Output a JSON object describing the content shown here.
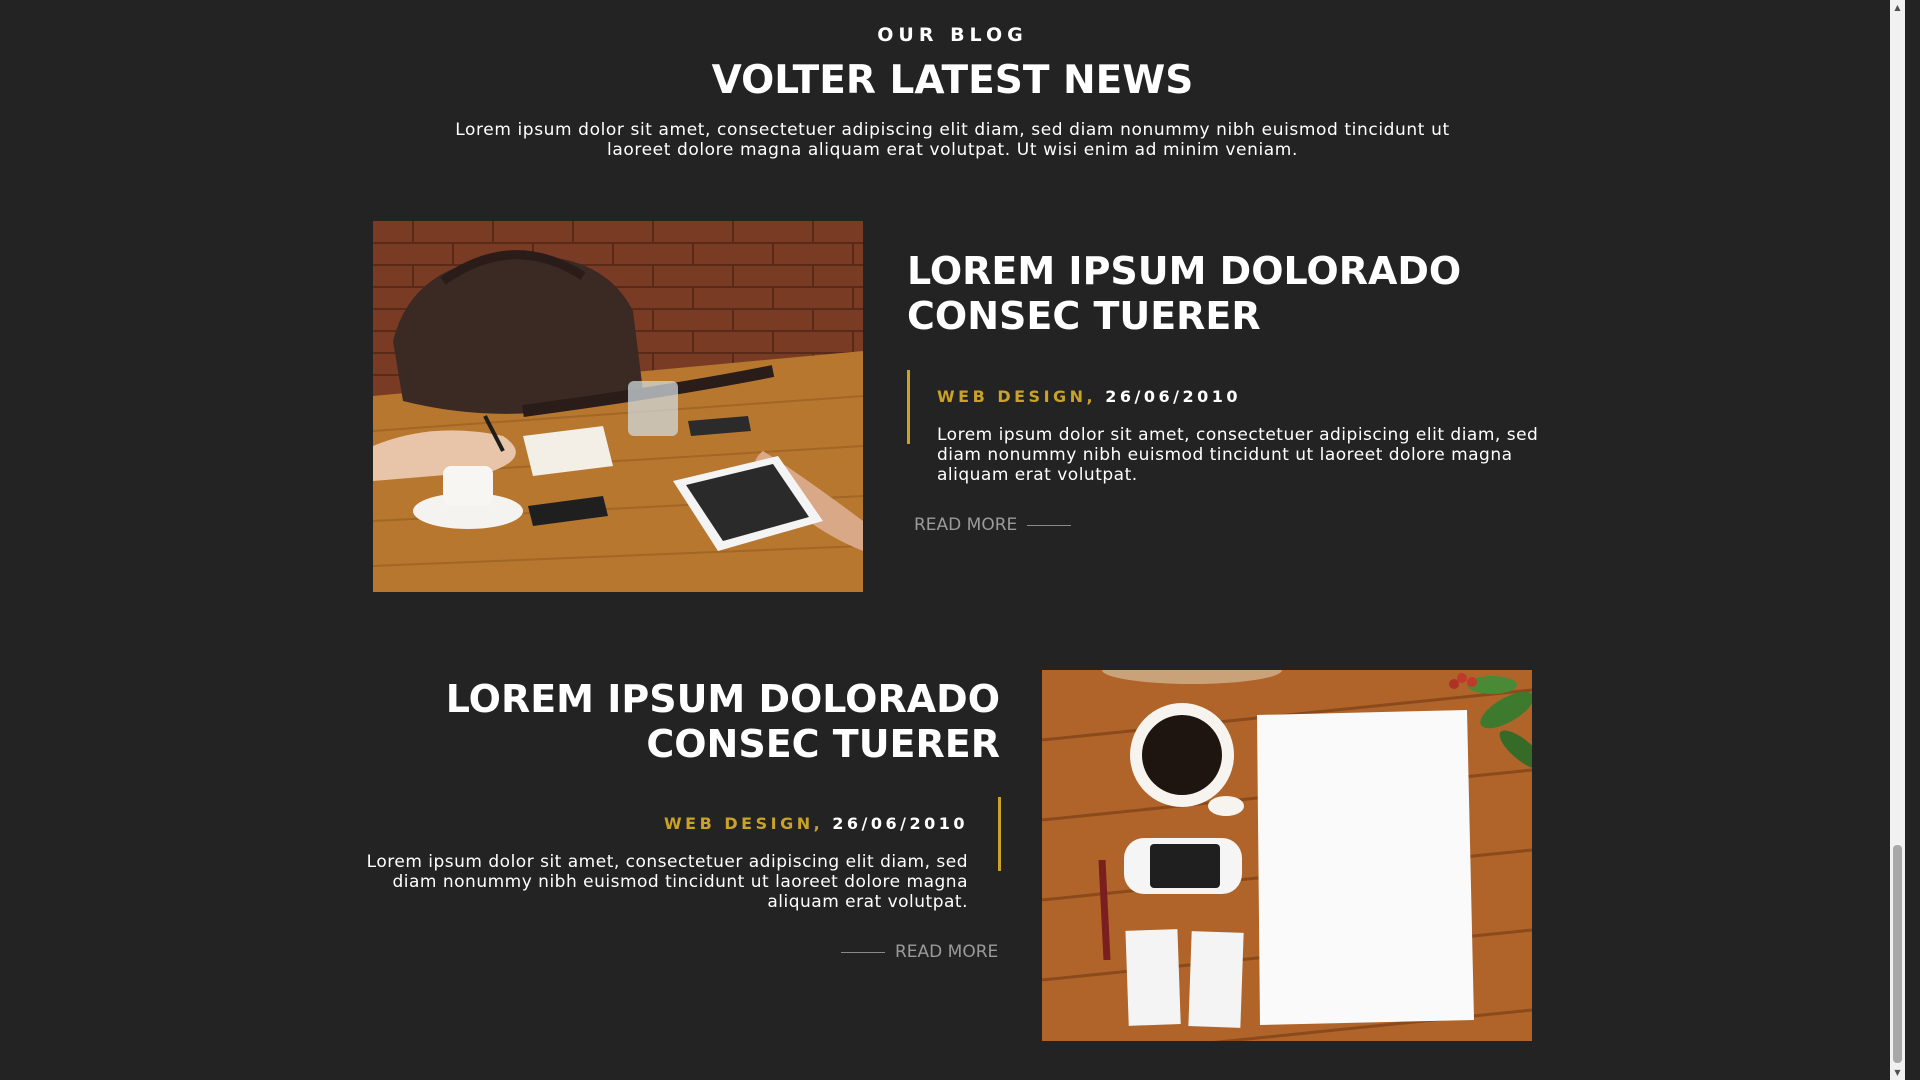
{
  "blog": {
    "eyebrow": "OUR BLOG",
    "heading": "VOLTER LATEST NEWS",
    "intro": "Lorem ipsum dolor sit amet, consectetuer adipiscing elit diam, sed diam nonummy nibh euismod tincidunt ut laoreet dolore magna aliquam erat volutpat. Ut wisi enim ad minim veniam."
  },
  "posts": [
    {
      "title": "LOREM IPSUM DOLORADO CONSEC TUERER",
      "category": "WEB DESIGN,",
      "date": "26/06/2010",
      "excerpt": "Lorem ipsum dolor sit amet, consectetuer adipiscing elit diam, sed diam nonummy nibh euismod tincidunt ut laoreet dolore magna aliquam erat volutpat.",
      "read_more": "READ MORE"
    },
    {
      "title": "LOREM IPSUM DOLORADO CONSEC TUERER",
      "category": "WEB DESIGN,",
      "date": "26/06/2010",
      "excerpt": "Lorem ipsum dolor sit amet, consectetuer adipiscing elit diam, sed diam nonummy nibh euismod tincidunt ut laoreet dolore magna aliquam erat volutpat.",
      "read_more": "READ MORE"
    }
  ],
  "colors": {
    "background": "#232323",
    "accent": "#c9a227",
    "text": "#ffffff",
    "muted": "#9a9a9a"
  }
}
